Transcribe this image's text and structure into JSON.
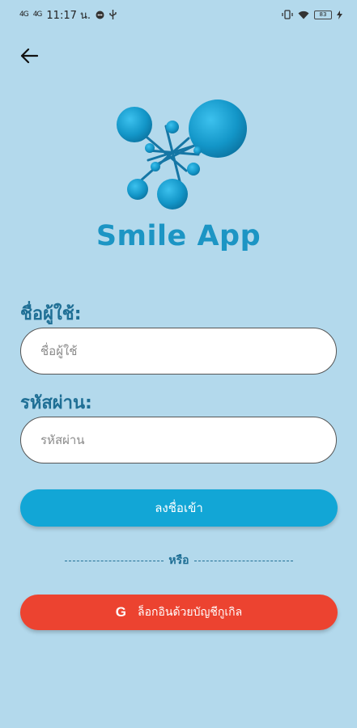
{
  "status_bar": {
    "signal_1": "4G",
    "signal_2": "4G",
    "time": "11:17 น.",
    "battery": "83"
  },
  "header": {
    "back_icon": "arrow-left-icon"
  },
  "app": {
    "name": "Smile App",
    "logo_icon": "molecule-logo"
  },
  "form": {
    "username_label": "ชื่อผู้ใช้:",
    "username_placeholder": "ชื่อผู้ใช้",
    "password_label": "รหัสผ่าน:",
    "password_placeholder": "รหัสผ่าน",
    "login_label": "ลงชื่อเข้า",
    "divider_text": "หรือ",
    "google_label": "ล็อกอินด้วยบัญชีกูเกิล",
    "google_icon_letter": "G"
  },
  "colors": {
    "background": "#b3d9ec",
    "brand": "#1c95c4",
    "login_button": "#12a6d6",
    "google_button": "#ec4330"
  }
}
